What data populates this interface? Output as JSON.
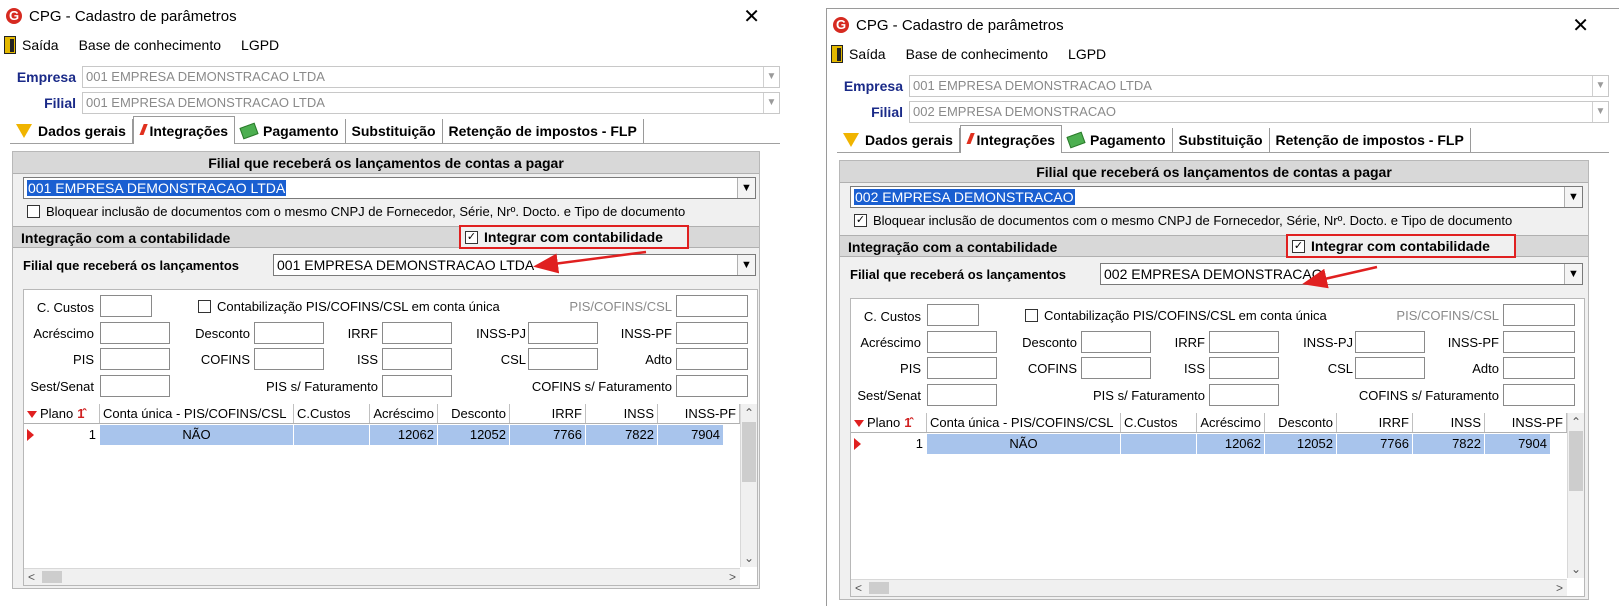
{
  "windows": [
    {
      "title": "CPG - Cadastro de parâmetros",
      "menu": [
        "Saída",
        "Base de conhecimento",
        "LGPD"
      ],
      "empresa_label": "Empresa",
      "empresa_value": "001 EMPRESA DEMONSTRACAO LTDA",
      "filial_label": "Filial",
      "filial_value": "001 EMPRESA DEMONSTRACAO LTDA",
      "tabs": [
        "Dados gerais",
        "Integrações",
        "Pagamento",
        "Substituição",
        "Retenção de impostos - FLP"
      ],
      "active_tab": "Integrações",
      "section_title": "Filial que receberá os lançamentos de contas a pagar",
      "filial_combo": "001 EMPRESA DEMONSTRACAO LTDA",
      "bloquear_label": "Bloquear inclusão de documentos com o mesmo CNPJ de Fornecedor, Série, Nrº. Docto. e Tipo de documento",
      "bloquear_checked": "",
      "contab_title": "Integração com a contabilidade",
      "integrar_label": "Integrar com contabilidade",
      "integrar_checked": "✓",
      "lanc_label": "Filial que receberá os lançamentos",
      "lanc_value": "001 EMPRESA DEMONSTRACAO LTDA",
      "fields": {
        "c_custos": "C. Custos",
        "contab_unica": "Contabilização PIS/COFINS/CSL em conta única",
        "pis_cofins_csl": "PIS/COFINS/CSL",
        "acrescimo": "Acréscimo",
        "desconto": "Desconto",
        "irrf": "IRRF",
        "inss_pj": "INSS-PJ",
        "inss_pf": "INSS-PF",
        "pis": "PIS",
        "cofins": "COFINS",
        "iss": "ISS",
        "csl": "CSL",
        "adto": "Adto",
        "sest_senat": "Sest/Senat",
        "pis_fat": "PIS s/ Faturamento",
        "cofins_fat": "COFINS s/ Faturamento"
      },
      "table_headers": [
        "Plano",
        "Conta única - PIS/COFINS/CSL",
        "C.Custos",
        "Acréscimo",
        "Desconto",
        "IRRF",
        "INSS",
        "INSS-PF"
      ],
      "table_row": [
        "1",
        "NÃO",
        "",
        "12062",
        "12052",
        "7766",
        "7822",
        "7904"
      ]
    },
    {
      "title": "CPG - Cadastro de parâmetros",
      "menu": [
        "Saída",
        "Base de conhecimento",
        "LGPD"
      ],
      "empresa_label": "Empresa",
      "empresa_value": "001 EMPRESA DEMONSTRACAO LTDA",
      "filial_label": "Filial",
      "filial_value": "002 EMPRESA DEMONSTRACAO",
      "tabs": [
        "Dados gerais",
        "Integrações",
        "Pagamento",
        "Substituição",
        "Retenção de impostos - FLP"
      ],
      "active_tab": "Integrações",
      "section_title": "Filial que receberá os lançamentos de contas a pagar",
      "filial_combo": "002 EMPRESA DEMONSTRACAO",
      "bloquear_label": "Bloquear inclusão de documentos com o mesmo CNPJ de Fornecedor, Série, Nrº. Docto. e Tipo de documento",
      "bloquear_checked": "✓",
      "contab_title": "Integração com a contabilidade",
      "integrar_label": "Integrar com contabilidade",
      "integrar_checked": "✓",
      "lanc_label": "Filial que receberá os lançamentos",
      "lanc_value": "002 EMPRESA DEMONSTRACAO",
      "fields": {
        "c_custos": "C. Custos",
        "contab_unica": "Contabilização PIS/COFINS/CSL em conta única",
        "pis_cofins_csl": "PIS/COFINS/CSL",
        "acrescimo": "Acréscimo",
        "desconto": "Desconto",
        "irrf": "IRRF",
        "inss_pj": "INSS-PJ",
        "inss_pf": "INSS-PF",
        "pis": "PIS",
        "cofins": "COFINS",
        "iss": "ISS",
        "csl": "CSL",
        "adto": "Adto",
        "sest_senat": "Sest/Senat",
        "pis_fat": "PIS s/ Faturamento",
        "cofins_fat": "COFINS s/ Faturamento"
      },
      "table_headers": [
        "Plano",
        "Conta única - PIS/COFINS/CSL",
        "C.Custos",
        "Acréscimo",
        "Desconto",
        "IRRF",
        "INSS",
        "INSS-PF"
      ],
      "table_row": [
        "1",
        "NÃO",
        "",
        "12062",
        "12052",
        "7766",
        "7822",
        "7904"
      ]
    }
  ],
  "icons": {
    "logo": "app-logo-icon",
    "close": "close-icon",
    "exit": "exit-door-icon",
    "dados_gerais": "filter-icon",
    "integracoes": "integration-icon",
    "pagamento": "money-icon"
  },
  "colors": {
    "highlight_red": "#e02020",
    "selection_blue": "#1a5fd1",
    "row_blue": "#a8c4ec",
    "label_blue": "#1a2a88"
  }
}
